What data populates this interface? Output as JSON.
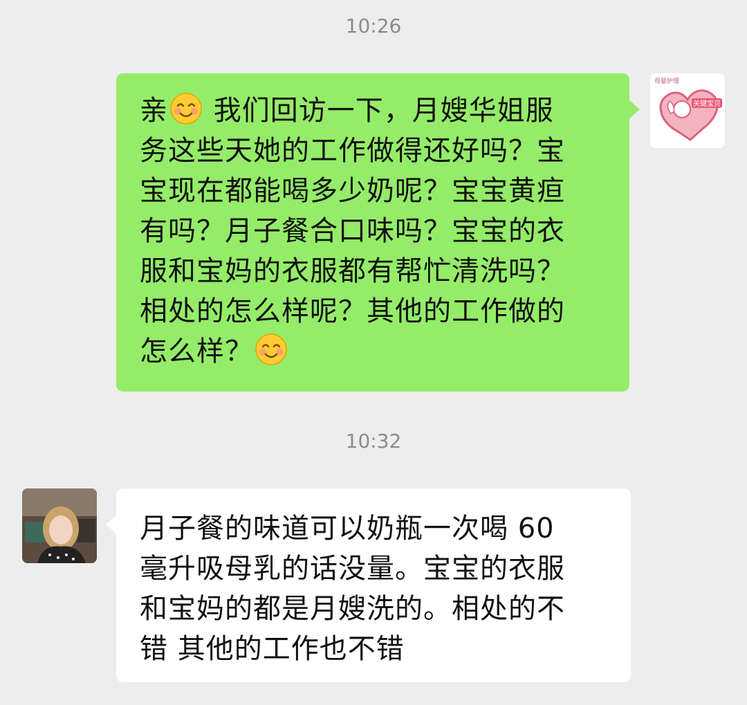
{
  "messages": [
    {
      "time": "10:26",
      "direction": "outgoing",
      "sender_avatar": {
        "icon": "heart-cupid-logo",
        "text_top": "母婴护理",
        "text_badge": "关键宝贝"
      },
      "lines": [
        {
          "before": "亲",
          "emoji": "smiling-face-emoji",
          "after": " 我们回访一下，月嫂华姐服"
        },
        {
          "text": "务这些天她的工作做得还好吗？宝"
        },
        {
          "text": "宝现在都能喝多少奶呢？宝宝黄疸"
        },
        {
          "text": "有吗？月子餐合口味吗？宝宝的衣"
        },
        {
          "text": "服和宝妈的衣服都有帮忙清洗吗？"
        },
        {
          "text": "相处的怎么样呢？其他的工作做的"
        },
        {
          "before": "怎么样？",
          "emoji": "smiling-face-emoji",
          "after": ""
        }
      ]
    },
    {
      "time": "10:32",
      "direction": "incoming",
      "sender_avatar": {
        "icon": "user-photo-avatar"
      },
      "lines": [
        {
          "text": "月子餐的味道可以奶瓶一次喝 60"
        },
        {
          "text": "毫升吸母乳的话没量。宝宝的衣服"
        },
        {
          "text": "和宝妈的都是月嫂洗的。相处的不"
        },
        {
          "text": "错 其他的工作也不错"
        }
      ]
    }
  ],
  "colors": {
    "background": "#ededed",
    "outgoing_bubble": "#95ec69",
    "incoming_bubble": "#ffffff",
    "timestamp": "#8a8a8a"
  }
}
